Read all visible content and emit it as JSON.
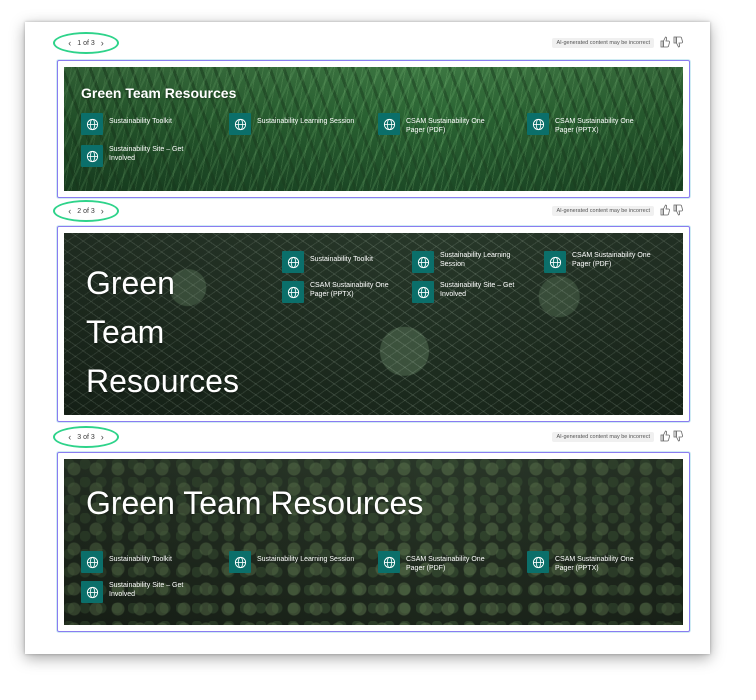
{
  "ai_disclaimer": "AI-generated content may be incorrect",
  "icons": {
    "link": "globe-icon",
    "prev": "chevron-left-icon",
    "next": "chevron-right-icon",
    "like": "thumbs-up-icon",
    "dislike": "thumbs-down-icon"
  },
  "colors": {
    "link_tile": "#0b6f6a",
    "pager_highlight": "#2ed38a",
    "frame_border": "#8a7cf0"
  },
  "variations": [
    {
      "pager": "1 of 3",
      "title": "Green Team Resources",
      "links": [
        "Sustainability Toolkit",
        "Sustainability Learning Session",
        "CSAM Sustainability One Pager (PDF)",
        "CSAM Sustainability One Pager (PPTX)",
        "Sustainability Site – Get Involved"
      ]
    },
    {
      "pager": "2 of 3",
      "title": "Green Team Resources",
      "links": [
        "Sustainability Toolkit",
        "Sustainability Learning Session",
        "CSAM Sustainability One Pager (PDF)",
        "CSAM Sustainability One Pager (PPTX)",
        "Sustainability Site – Get Involved"
      ]
    },
    {
      "pager": "3 of 3",
      "title": "Green Team Resources",
      "links": [
        "Sustainability Toolkit",
        "Sustainability Learning Session",
        "CSAM Sustainability One Pager (PDF)",
        "CSAM Sustainability One Pager (PPTX)",
        "Sustainability Site – Get Involved"
      ]
    }
  ]
}
